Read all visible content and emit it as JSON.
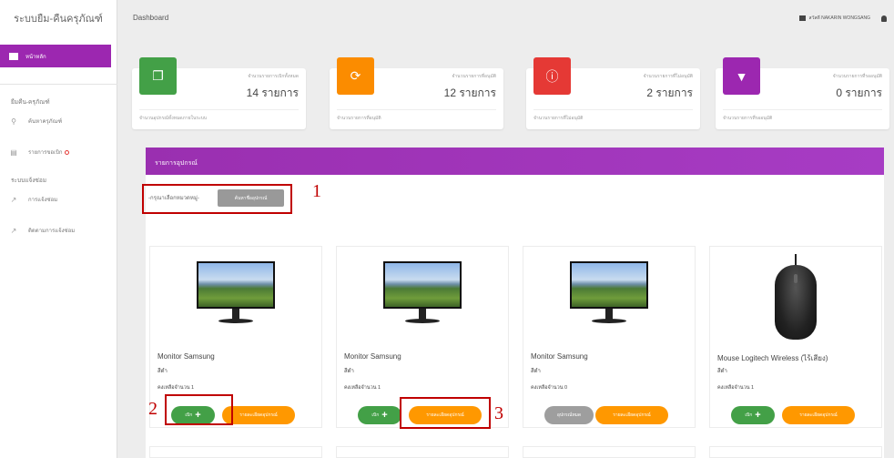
{
  "sidebar": {
    "brand": "ระบบยืม-คืนครุภัณฑ์",
    "active_item": "หน้าหลัก",
    "section_borrow": "ยืมคืน-ครุภัณฑ์",
    "item_search": "ค้นหาครุภัณฑ์",
    "item_borrow_list": "รายการขอเบิก",
    "section_repair": "ระบบแจ้งซ่อม",
    "item_repair": "การแจ้งซ่อม",
    "item_track": "ติดตามการแจ้งซ่อม"
  },
  "topbar": {
    "title": "Dashboard",
    "user": "สวัสดี NAKARIN WONGSANG"
  },
  "stats": [
    {
      "caption": "จำนวนรายการเบิกทั้งหมด",
      "value": "14 รายการ",
      "footer": "จำนวนอุปกรณ์ทั้งหมดภายในระบบ",
      "color": "#43a047",
      "icon": "copy-icon"
    },
    {
      "caption": "จำนวนรายการที่อนุมัติ",
      "value": "12 รายการ",
      "footer": "จำนวนรายการที่อนุมัติ",
      "color": "#fb8c00",
      "icon": "refresh-icon"
    },
    {
      "caption": "จำนวนรายการที่ไม่อนุมัติ",
      "value": "2 รายการ",
      "footer": "จำนวนรายการที่ไม่อนุมัติ",
      "color": "#e53935",
      "icon": "info-icon"
    },
    {
      "caption": "จำนวนรายการที่รออนุมัติ",
      "value": "0 รายการ",
      "footer": "จำนวนรายการที่รออนุมัติ",
      "color": "#9c27b0",
      "icon": "thumbs-down-icon"
    }
  ],
  "panel": {
    "title": "รายการอุปกรณ์",
    "filter_placeholder": "-กรุณาเลือกหมวดหมู่-",
    "filter_button": "ค้นหาชื่ออุปกรณ์"
  },
  "annotations": [
    "1",
    "2",
    "3"
  ],
  "products": [
    {
      "name": "Monitor Samsung",
      "color": "สีดำ",
      "stock": "คงเหลือจำนวน 1",
      "action": "borrow",
      "action_label": "เบิก",
      "detail_label": "รายละเอียดอุปกรณ์"
    },
    {
      "name": "Monitor Samsung",
      "color": "สีดำ",
      "stock": "คงเหลือจำนวน 1",
      "action": "borrow",
      "action_label": "เบิก",
      "detail_label": "รายละเอียดอุปกรณ์"
    },
    {
      "name": "Monitor Samsung",
      "color": "สีดำ",
      "stock": "คงเหลือจำนวน 0",
      "action": "out",
      "action_label": "อุปกรณ์หมด",
      "detail_label": "รายละเอียดอุปกรณ์"
    },
    {
      "name": "Mouse Logitech Wireless (ไร้เสียง)",
      "color": "สีดำ",
      "stock": "คงเหลือจำนวน 1",
      "action": "borrow",
      "action_label": "เบิก",
      "detail_label": "รายละเอียดอุปกรณ์"
    }
  ]
}
